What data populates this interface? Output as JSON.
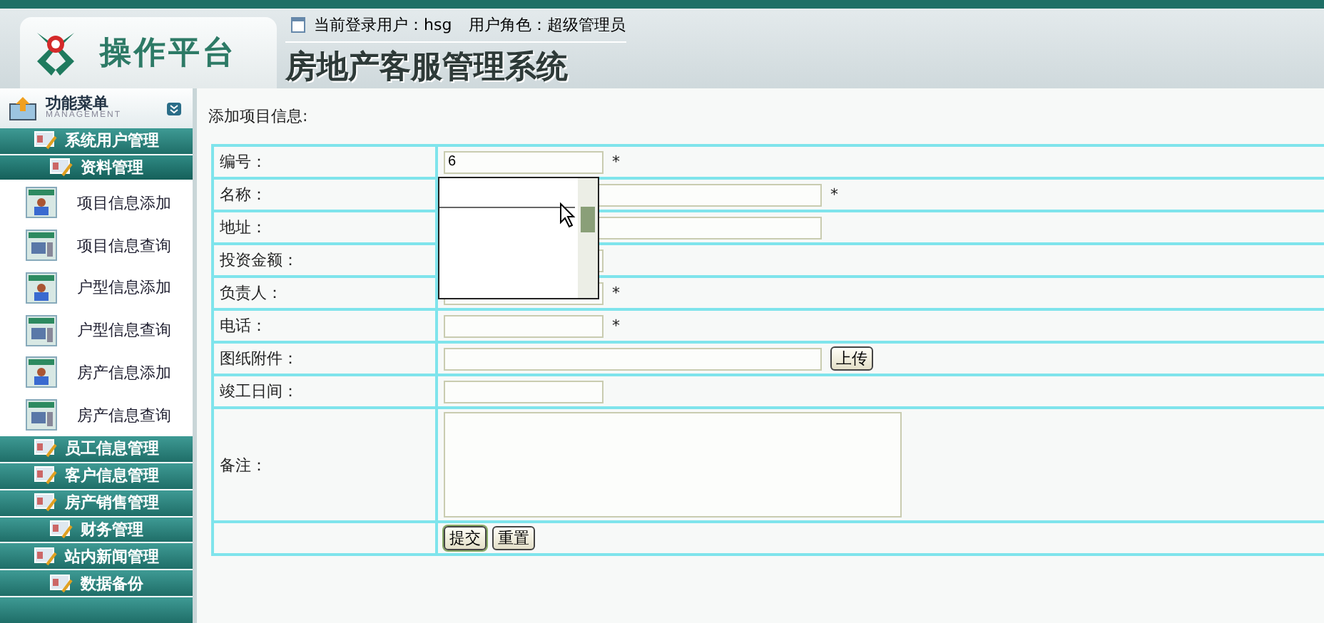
{
  "header": {
    "logo_text": "操作平台",
    "user_label": "当前登录用户：",
    "user": "hsg",
    "role_label": "用户角色：",
    "role": "超级管理员",
    "system_title": "房地产客服管理系统"
  },
  "sidebar": {
    "title": "功能菜单",
    "subtitle": "MANAGEMENT",
    "groups": [
      {
        "label": "系统用户管理",
        "expanded": false
      },
      {
        "label": "资料管理",
        "expanded": true,
        "children": [
          {
            "label": "项目信息添加",
            "kind": "add"
          },
          {
            "label": "项目信息查询",
            "kind": "query"
          },
          {
            "label": "户型信息添加",
            "kind": "add"
          },
          {
            "label": "户型信息查询",
            "kind": "query"
          },
          {
            "label": "房产信息添加",
            "kind": "add"
          },
          {
            "label": "房产信息查询",
            "kind": "query"
          }
        ]
      },
      {
        "label": "员工信息管理",
        "expanded": false
      },
      {
        "label": "客户信息管理",
        "expanded": false
      },
      {
        "label": "房产销售管理",
        "expanded": false
      },
      {
        "label": "财务管理",
        "expanded": false
      },
      {
        "label": "站内新闻管理",
        "expanded": false
      },
      {
        "label": "数据备份",
        "expanded": false
      }
    ]
  },
  "form": {
    "title": "添加项目信息:",
    "fields": [
      {
        "label": "编号：",
        "kind": "short",
        "value": "6",
        "required": true,
        "autocomplete_open": true
      },
      {
        "label": "名称：",
        "kind": "long",
        "required": true
      },
      {
        "label": "地址：",
        "kind": "long",
        "required": false
      },
      {
        "label": "投资金额：",
        "kind": "short",
        "required": false
      },
      {
        "label": "负责人：",
        "kind": "short",
        "required": true
      },
      {
        "label": "电话：",
        "kind": "short",
        "required": true
      },
      {
        "label": "图纸附件：",
        "kind": "file",
        "required": false,
        "button": "上传"
      },
      {
        "label": "竣工日间：",
        "kind": "short",
        "required": false
      },
      {
        "label": "备注：",
        "kind": "textarea",
        "required": false
      }
    ],
    "required_mark": "*",
    "buttons": [
      {
        "label": "提交",
        "kind": "submit"
      },
      {
        "label": "重置",
        "kind": "reset"
      }
    ]
  }
}
